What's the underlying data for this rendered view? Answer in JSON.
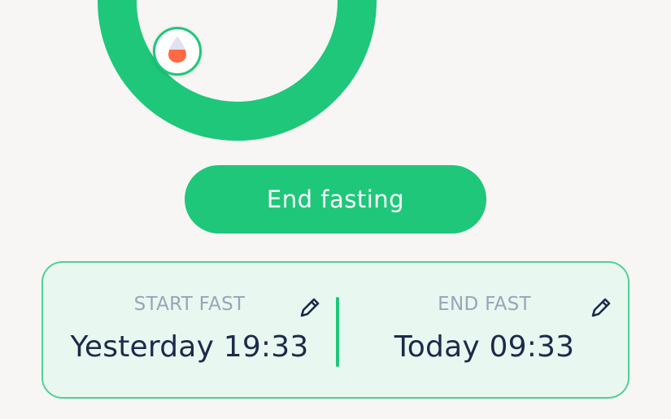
{
  "fasting_ring": {
    "color": "#1fc77a",
    "badge_icon": "water-drop-icon"
  },
  "end_button": {
    "label": "End fasting",
    "color": "#1fc77a"
  },
  "fast_card": {
    "start": {
      "label": "START FAST",
      "value": "Yesterday 19:33",
      "edit_icon": "pencil-icon"
    },
    "end": {
      "label": "END FAST",
      "value": "Today 09:33",
      "edit_icon": "pencil-icon"
    },
    "accent": "#1fc77a"
  }
}
